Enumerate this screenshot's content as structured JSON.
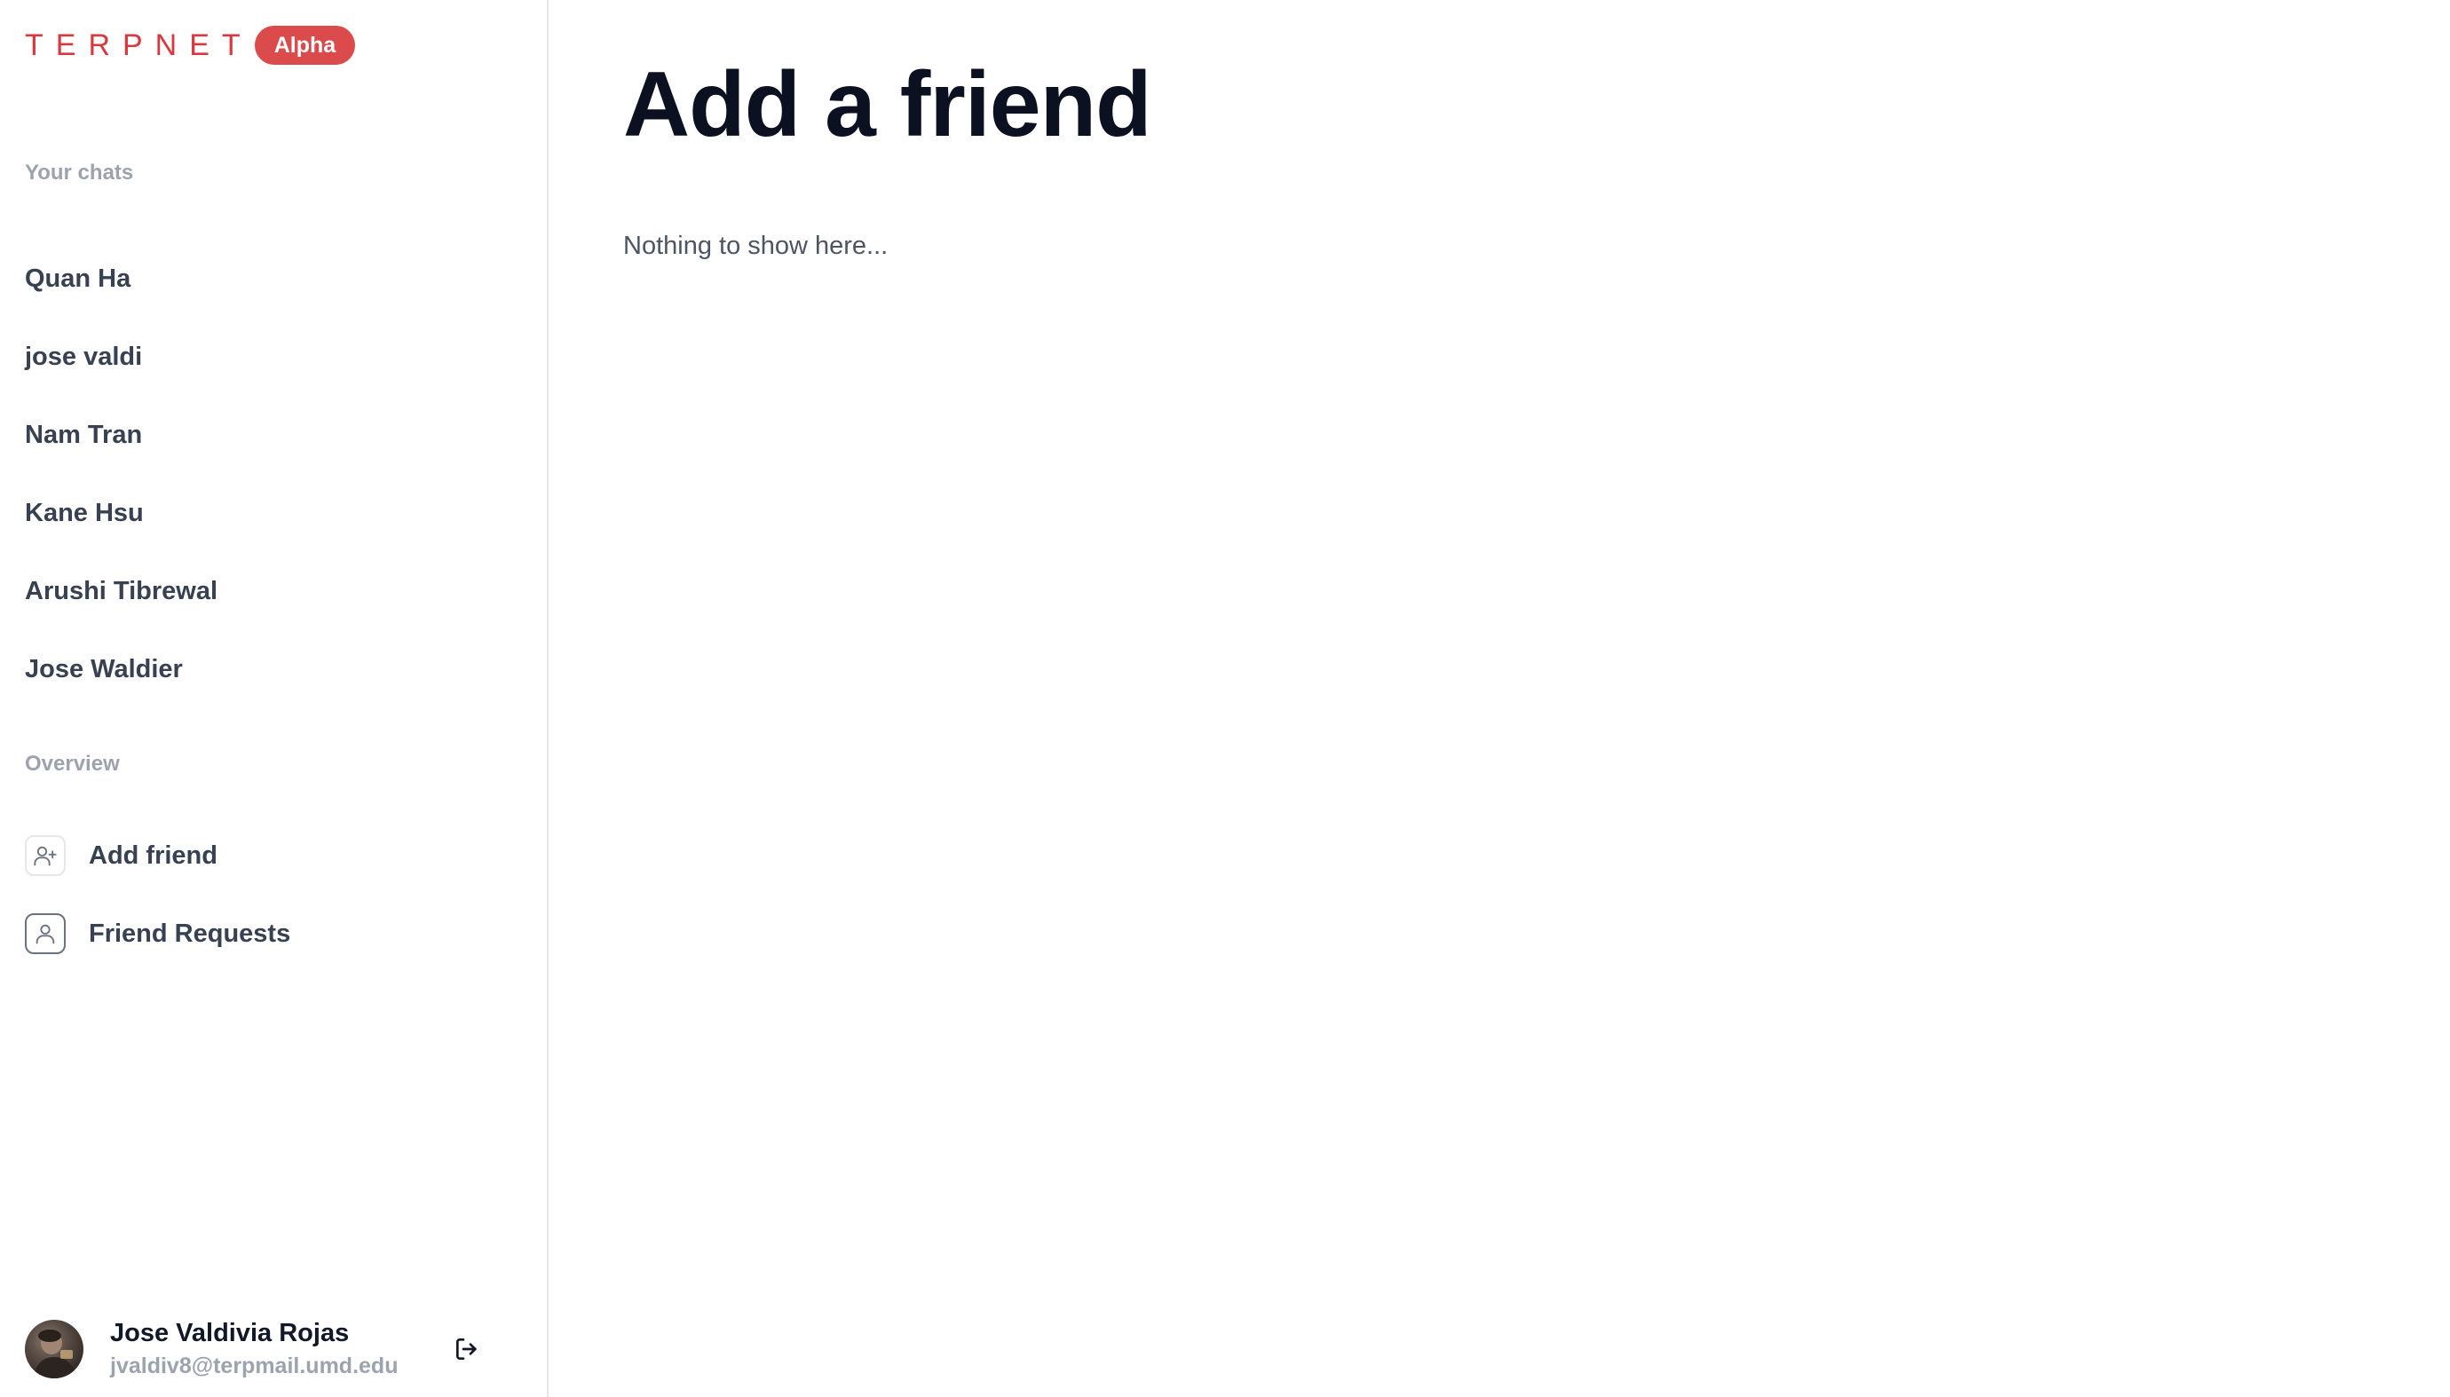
{
  "brand": {
    "name": "TERPNET",
    "badge": "Alpha"
  },
  "sidebar": {
    "chats_label": "Your chats",
    "chats": [
      {
        "name": "Quan Ha"
      },
      {
        "name": "jose valdi"
      },
      {
        "name": "Nam Tran"
      },
      {
        "name": "Kane Hsu"
      },
      {
        "name": "Arushi Tibrewal"
      },
      {
        "name": "Jose Waldier"
      }
    ],
    "overview_label": "Overview",
    "overview": [
      {
        "label": "Add friend",
        "icon": "user-plus-icon"
      },
      {
        "label": "Friend Requests",
        "icon": "user-icon"
      }
    ]
  },
  "profile": {
    "name": "Jose Valdivia Rojas",
    "email": "jvaldiv8@terpmail.umd.edu"
  },
  "main": {
    "title": "Add a friend",
    "empty_text": "Nothing to show here..."
  },
  "colors": {
    "brand": "#d9383f",
    "badge": "#dc4b4b",
    "muted": "#9ca3af",
    "text": "#374151",
    "title": "#0b1120"
  }
}
